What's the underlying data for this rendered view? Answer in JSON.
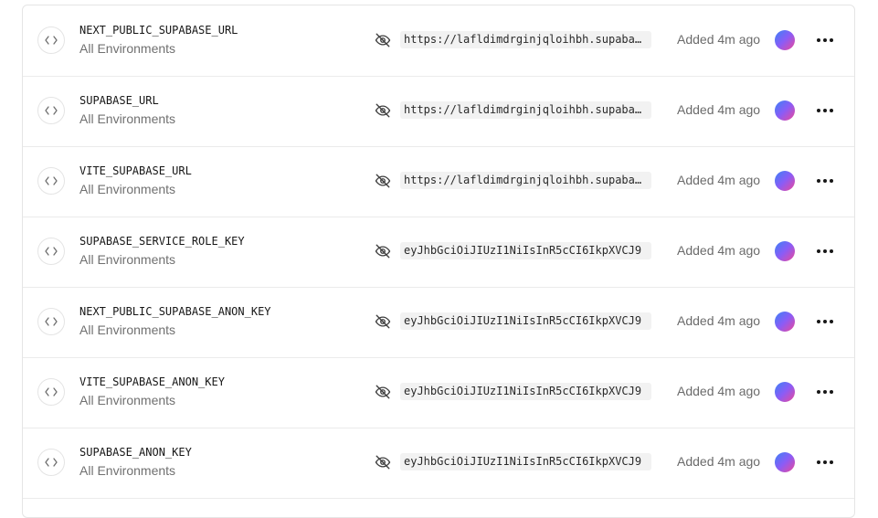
{
  "rows": [
    {
      "name": "NEXT_PUBLIC_SUPABASE_URL",
      "env": "All Environments",
      "value": "https://lafldimdrginjqloihbh.supabase.co",
      "added": "Added 4m ago"
    },
    {
      "name": "SUPABASE_URL",
      "env": "All Environments",
      "value": "https://lafldimdrginjqloihbh.supabase.co",
      "added": "Added 4m ago"
    },
    {
      "name": "VITE_SUPABASE_URL",
      "env": "All Environments",
      "value": "https://lafldimdrginjqloihbh.supabase.co",
      "added": "Added 4m ago"
    },
    {
      "name": "SUPABASE_SERVICE_ROLE_KEY",
      "env": "All Environments",
      "value": "eyJhbGciOiJIUzI1NiIsInR5cCI6IkpXVCJ9",
      "added": "Added 4m ago"
    },
    {
      "name": "NEXT_PUBLIC_SUPABASE_ANON_KEY",
      "env": "All Environments",
      "value": "eyJhbGciOiJIUzI1NiIsInR5cCI6IkpXVCJ9",
      "added": "Added 4m ago"
    },
    {
      "name": "VITE_SUPABASE_ANON_KEY",
      "env": "All Environments",
      "value": "eyJhbGciOiJIUzI1NiIsInR5cCI6IkpXVCJ9",
      "added": "Added 4m ago"
    },
    {
      "name": "SUPABASE_ANON_KEY",
      "env": "All Environments",
      "value": "eyJhbGciOiJIUzI1NiIsInR5cCI6IkpXVCJ9",
      "added": "Added 4m ago"
    }
  ],
  "icons": {
    "row_type": "code-icon",
    "visibility": "eye-off-icon",
    "user": "avatar",
    "menu": "more-horizontal-icon"
  },
  "colors": {
    "avatar_gradient": [
      "#3b82f6",
      "#8b5cf6",
      "#ec4899"
    ],
    "value_bg": "#f2f2f2",
    "muted_text": "#707070"
  }
}
